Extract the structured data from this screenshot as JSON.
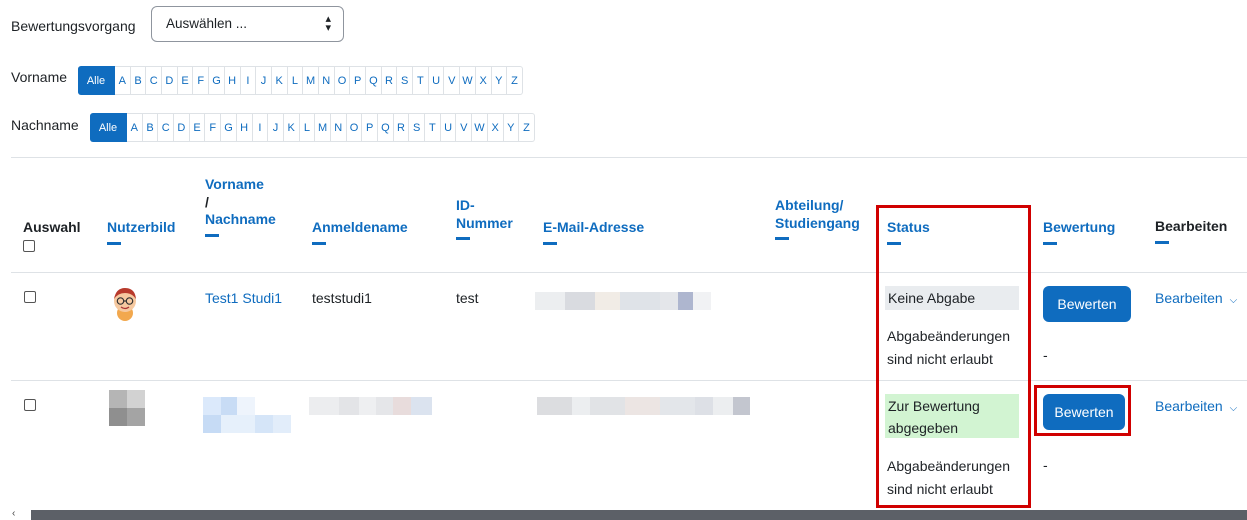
{
  "grading_action": {
    "label": "Bewertungsvorgang",
    "selected": "Auswählen ..."
  },
  "initials": {
    "firstname_label": "Vorname",
    "lastname_label": "Nachname",
    "all_label": "Alle",
    "letters": [
      "A",
      "B",
      "C",
      "D",
      "E",
      "F",
      "G",
      "H",
      "I",
      "J",
      "K",
      "L",
      "M",
      "N",
      "O",
      "P",
      "Q",
      "R",
      "S",
      "T",
      "U",
      "V",
      "W",
      "X",
      "Y",
      "Z"
    ]
  },
  "table": {
    "headers": {
      "select": "Auswahl",
      "picture": "Nutzerbild",
      "firstname": "Vorname",
      "slash": "/",
      "lastname": "Nachname",
      "username": "Anmeldename",
      "idnumber_1": "ID-",
      "idnumber_2": "Nummer",
      "email": "E-Mail-Adresse",
      "department_1": "Abteilung/",
      "department_2": "Studiengang",
      "status": "Status",
      "grade": "Bewertung",
      "edit": "Bearbeiten"
    },
    "rows": [
      {
        "name": "Test1 Studi1",
        "username": "teststudi1",
        "idnumber": "test",
        "status": "Keine Abgabe",
        "status_color": "#e9ecef",
        "status_note_1": "Abgabeänderungen",
        "status_note_2": "sind nicht erlaubt",
        "grade_button": "Bewerten",
        "grade_value": "-",
        "edit_label": "Bearbeiten"
      },
      {
        "status_1": "Zur Bewertung",
        "status_2": "abgegeben",
        "status_color": "#d2f4d2",
        "status_note_1": "Abgabeänderungen",
        "status_note_2": "sind nicht erlaubt",
        "grade_button": "Bewerten",
        "grade_value": "-",
        "edit_label": "Bearbeiten"
      }
    ]
  },
  "colors": {
    "accent": "#0f6cbf",
    "highlight_frame": "#d00000"
  }
}
